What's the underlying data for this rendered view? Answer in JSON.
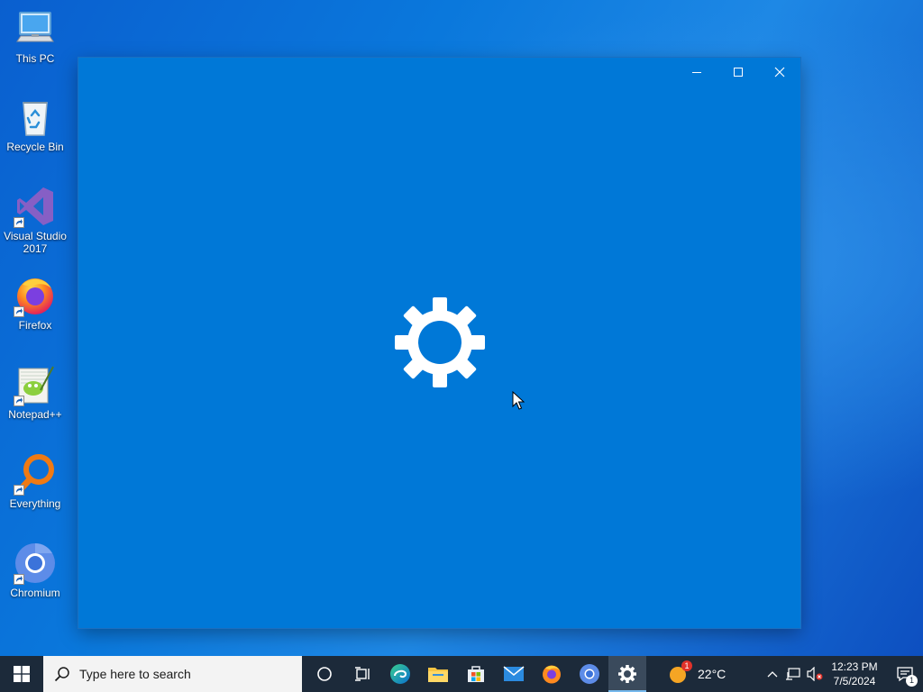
{
  "desktop": {
    "icons": [
      {
        "label": "This PC",
        "icon": "computer-icon"
      },
      {
        "label": "Recycle Bin",
        "icon": "recycle-bin-icon"
      },
      {
        "label": "Visual Studio 2017",
        "icon": "visual-studio-icon"
      },
      {
        "label": "Firefox",
        "icon": "firefox-icon"
      },
      {
        "label": "Notepad++",
        "icon": "notepad-plus-plus-icon"
      },
      {
        "label": "Everything",
        "icon": "everything-search-icon"
      },
      {
        "label": "Chromium",
        "icon": "chromium-icon"
      }
    ]
  },
  "splash_window": {
    "icon": "gear-icon",
    "controls": [
      "minimize",
      "maximize",
      "close"
    ],
    "background": "#0078d7"
  },
  "taskbar": {
    "search_placeholder": "Type here to search",
    "pinned": [
      "cortana",
      "task-view",
      "edge",
      "file-explorer",
      "microsoft-store",
      "mail",
      "firefox",
      "chromium",
      "settings"
    ],
    "active_app": "settings",
    "weather": {
      "temp": "22°C",
      "badge": "1"
    },
    "clock": {
      "time": "12:23 PM",
      "date": "7/5/2024"
    },
    "notification_count": "1"
  },
  "colors": {
    "accent": "#0078d7",
    "taskbar": "#1c2a3a"
  }
}
